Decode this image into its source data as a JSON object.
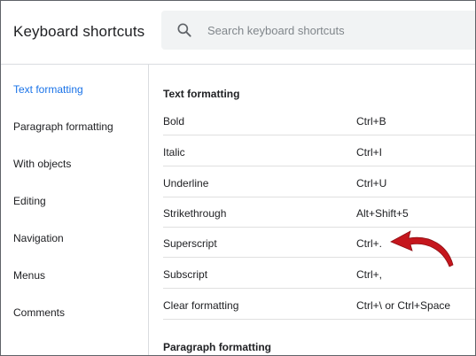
{
  "header": {
    "title": "Keyboard shortcuts",
    "search_placeholder": "Search keyboard shortcuts",
    "search_value": ""
  },
  "sidebar": {
    "items": [
      {
        "label": "Text formatting",
        "active": true
      },
      {
        "label": "Paragraph formatting",
        "active": false
      },
      {
        "label": "With objects",
        "active": false
      },
      {
        "label": "Editing",
        "active": false
      },
      {
        "label": "Navigation",
        "active": false
      },
      {
        "label": "Menus",
        "active": false
      },
      {
        "label": "Comments",
        "active": false
      }
    ]
  },
  "sections": [
    {
      "title": "Text formatting",
      "shortcuts": [
        {
          "name": "Bold",
          "keys": "Ctrl+B"
        },
        {
          "name": "Italic",
          "keys": "Ctrl+I"
        },
        {
          "name": "Underline",
          "keys": "Ctrl+U"
        },
        {
          "name": "Strikethrough",
          "keys": "Alt+Shift+5"
        },
        {
          "name": "Superscript",
          "keys": "Ctrl+."
        },
        {
          "name": "Subscript",
          "keys": "Ctrl+,"
        },
        {
          "name": "Clear formatting",
          "keys": "Ctrl+\\ or Ctrl+Space"
        }
      ]
    },
    {
      "title": "Paragraph formatting",
      "shortcuts": []
    }
  ],
  "colors": {
    "accent": "#1a73e8",
    "annotation_arrow": "#c5161d",
    "search_bg": "#f1f3f4",
    "divider": "#dadce0"
  },
  "icons": {
    "search": "search-icon",
    "annotation": "red-arrow-icon"
  }
}
